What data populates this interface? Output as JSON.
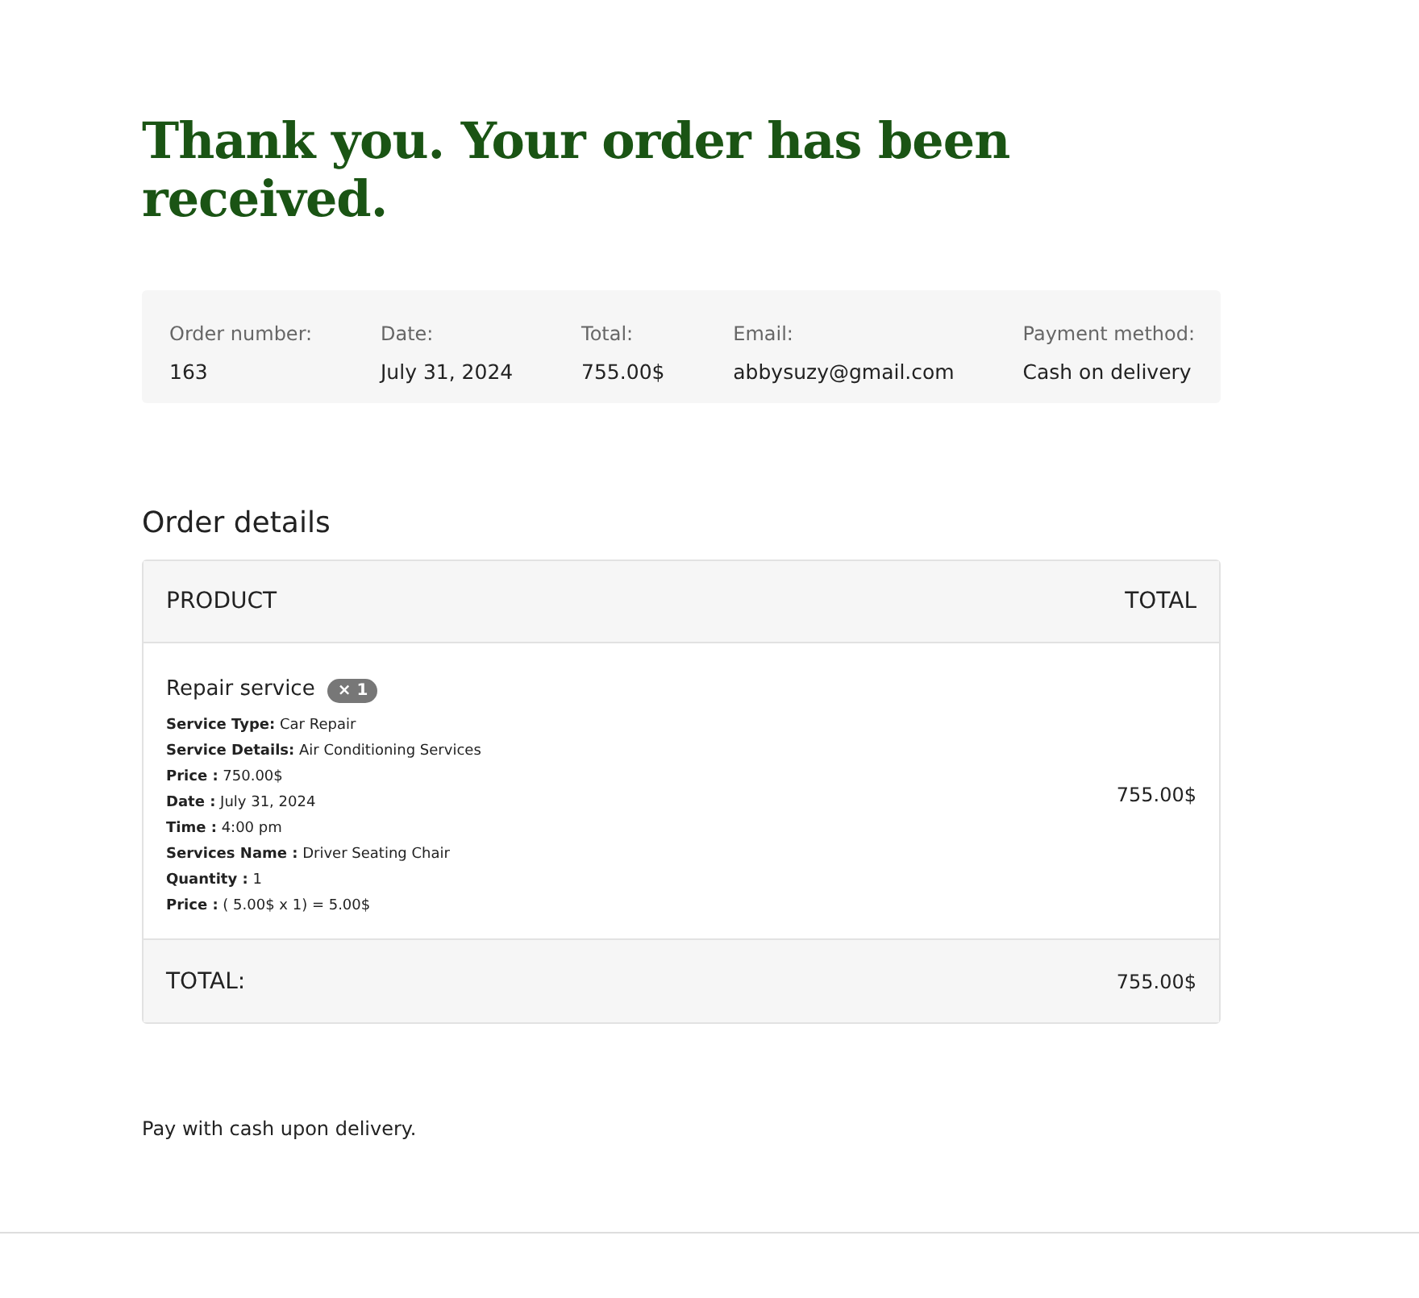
{
  "heading": "Thank you. Your order has been received.",
  "summary": [
    {
      "label": "Order number:",
      "value": "163"
    },
    {
      "label": "Date:",
      "value": "July 31, 2024"
    },
    {
      "label": "Total:",
      "value": "755.00$"
    },
    {
      "label": "Email:",
      "value": "abbysuzy@gmail.com"
    },
    {
      "label": "Payment method:",
      "value": "Cash on delivery"
    }
  ],
  "details_title": "Order details",
  "table": {
    "columns": [
      "PRODUCT",
      "TOTAL"
    ],
    "rows": [
      {
        "product": "Repair service",
        "quantity_badge": "× 1",
        "meta": [
          "**Service Type:** Car Repair",
          "**Service Details:** Air Conditioning Services",
          "**Price :** 750.00$",
          "**Date :** July 31, 2024",
          "**Time :** 4:00 pm",
          "**Services Name :** Driver Seating Chair",
          "**Quantity :** 1",
          "**Price :** ( 5.00$ x 1) = 5.00$"
        ],
        "total": "755.00$"
      }
    ],
    "footer": {
      "label": "TOTAL:",
      "value": "755.00$"
    }
  },
  "payment_note": "Pay with cash upon delivery."
}
